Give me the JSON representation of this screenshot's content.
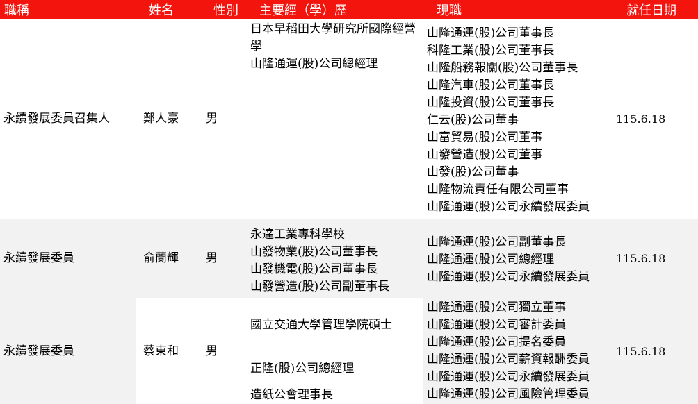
{
  "header": {
    "title": "職稱",
    "name": "姓名",
    "gender": "性別",
    "education": "主要經（學）歷",
    "current_position": "現職",
    "start_date": "就任日期"
  },
  "header_color": "#f4140e",
  "rows": [
    {
      "title": "永續發展委員召集人",
      "name": "鄭人豪",
      "gender": "男",
      "education": [
        "日本早稻田大學研究所國際經營學",
        "山隆通運(股)公司總經理"
      ],
      "positions": [
        "山隆通運(股)公司董事長",
        "科隆工業(股)公司董事長",
        "山隆船務報關(股)公司董事長",
        "山隆汽車(股)公司董事長",
        "山隆投資(股)公司董事長",
        "仁云(股)公司董事",
        "山富貿易(股)公司董事",
        "山發營造(股)公司董事",
        "山發(股)公司董事",
        "山隆物流責任有限公司董事",
        "山隆通運(股)公司永續發展委員"
      ],
      "date": "115.6.18"
    },
    {
      "title": "永續發展委員",
      "name": "俞蘭輝",
      "gender": "男",
      "education": [
        "永達工業專科學校",
        "山發物業(股)公司董事長",
        "山發機電(股)公司董事長",
        "山發營造(股)公司副董事長"
      ],
      "positions": [
        "山隆通運(股)公司副董事長",
        "山隆通運(股)公司總經理",
        "山隆通運(股)公司永續發展委員"
      ],
      "date": "115.6.18"
    },
    {
      "title": "永續發展委員",
      "name": "蔡東和",
      "gender": "男",
      "education": [
        "國立交通大學管理學院碩士",
        "正隆(股)公司總經理",
        "造紙公會理事長"
      ],
      "positions": [
        "山隆通運(股)公司獨立董事",
        "山隆通運(股)公司審計委員",
        "山隆通運(股)公司提名委員",
        "山隆通運(股)公司薪資報酬委員",
        "山隆通運(股)公司永續發展委員",
        "山隆通運(股)公司風險管理委員"
      ],
      "date": "115.6.18"
    }
  ]
}
